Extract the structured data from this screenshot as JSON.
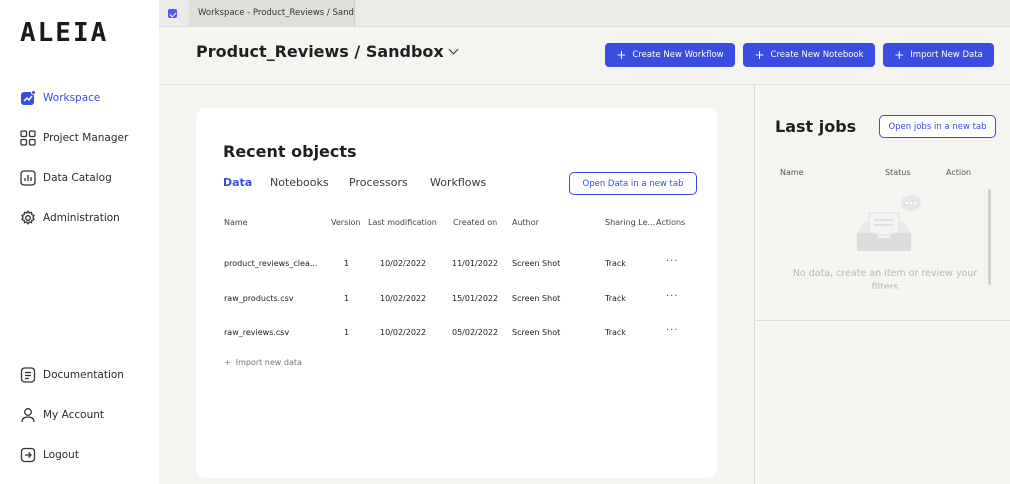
{
  "app": {
    "logo": "ALEIA"
  },
  "sidebar": {
    "items": [
      {
        "label": "Workspace",
        "icon": "workspace-icon",
        "active": true
      },
      {
        "label": "Project Manager",
        "icon": "grid-icon"
      },
      {
        "label": "Data Catalog",
        "icon": "chart-icon"
      },
      {
        "label": "Administration",
        "icon": "gear-icon"
      }
    ],
    "bottom": [
      {
        "label": "Documentation",
        "icon": "document-icon"
      },
      {
        "label": "My Account",
        "icon": "user-icon"
      },
      {
        "label": "Logout",
        "icon": "logout-icon"
      }
    ]
  },
  "tabs": [
    {
      "label": "Workspace - Product_Reviews / Sandbox"
    }
  ],
  "header": {
    "title": "Product_Reviews / Sandbox",
    "buttons": {
      "create_workflow": "Create New Workflow",
      "create_notebook": "Create New Notebook",
      "import_data": "Import New Data"
    }
  },
  "recent": {
    "title": "Recent objects",
    "tabs": [
      "Data",
      "Notebooks",
      "Processors",
      "Workflows"
    ],
    "open_tab_button": "Open Data in a new tab",
    "columns": [
      "Name",
      "Version",
      "Last modification",
      "Created on",
      "Author",
      "Sharing Le...",
      "Actions"
    ],
    "rows": [
      {
        "name": "product_reviews_clea...",
        "version": "1",
        "modified": "10/02/2022",
        "created": "11/01/2022",
        "author": "Screen Shot",
        "sharing": "Track",
        "actions": "···"
      },
      {
        "name": "raw_products.csv",
        "version": "1",
        "modified": "10/02/2022",
        "created": "15/01/2022",
        "author": "Screen Shot",
        "sharing": "Track",
        "actions": "···"
      },
      {
        "name": "raw_reviews.csv",
        "version": "1",
        "modified": "10/02/2022",
        "created": "05/02/2022",
        "author": "Screen Shot",
        "sharing": "Track",
        "actions": "···"
      }
    ],
    "import_link": "Import new data"
  },
  "jobs": {
    "title": "Last jobs",
    "open_button": "Open jobs in a new tab",
    "columns": [
      "Name",
      "Status",
      "Action"
    ],
    "empty_text": "No data, create an item or review your filters"
  },
  "colors": {
    "accent": "#3b4de0",
    "background": "#f5f4f1"
  }
}
